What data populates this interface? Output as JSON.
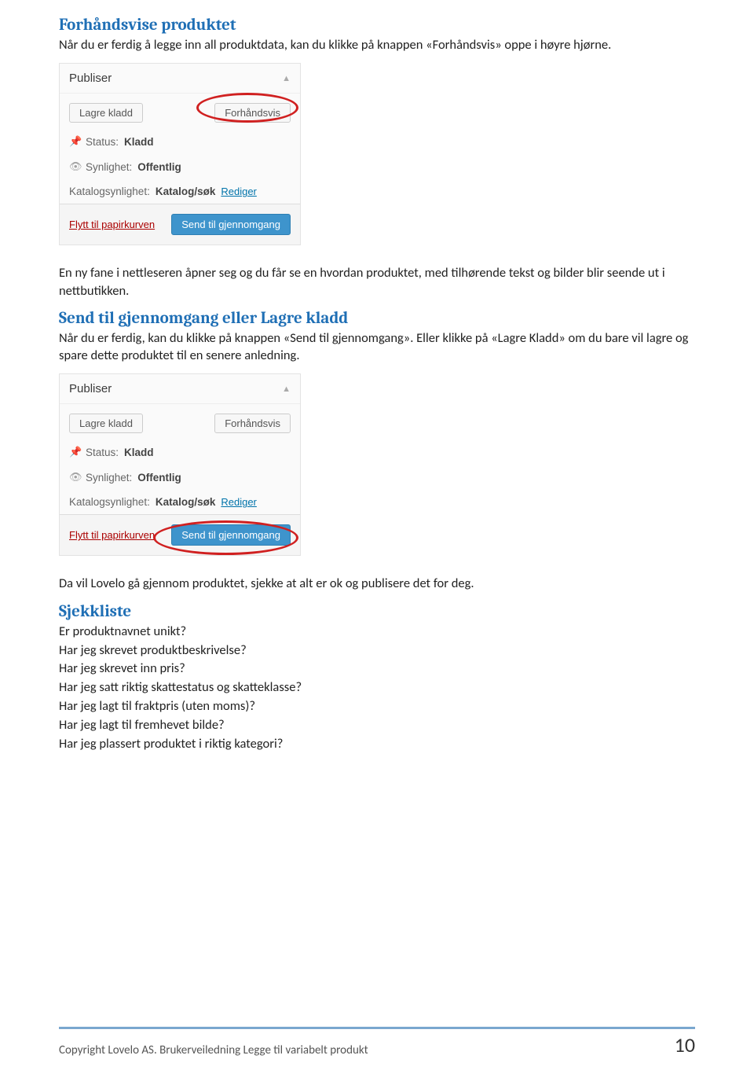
{
  "section1": {
    "heading": "Forhåndsvise produktet",
    "body": "Når du er ferdig å legge inn all produktdata, kan du klikke på knappen «Forhåndsvis» oppe i høyre hjørne."
  },
  "panel": {
    "title": "Publiser",
    "btn_save": "Lagre kladd",
    "btn_preview": "Forhåndsvis",
    "status_label": "Status:",
    "status_value": "Kladd",
    "visibility_label": "Synlighet:",
    "visibility_value": "Offentlig",
    "catalog_label": "Katalogsynlighet:",
    "catalog_value": "Katalog/søk",
    "catalog_edit": "Rediger",
    "trash": "Flytt til papirkurven",
    "submit": "Send til gjennomgang"
  },
  "section2": {
    "body": "En ny fane i nettleseren åpner seg og du får se en hvordan produktet, med tilhørende tekst og bilder blir seende ut i nettbutikken."
  },
  "section3": {
    "heading": "Send til gjennomgang eller Lagre kladd",
    "body": "Når du er ferdig, kan du klikke på knappen «Send til gjennomgang». Eller klikke på «Lagre Kladd» om du bare vil lagre og spare dette produktet til en senere anledning."
  },
  "section4": {
    "body": "Da vil Lovelo gå gjennom produktet, sjekke at alt er ok og publisere det for deg."
  },
  "checklist": {
    "heading": "Sjekkliste",
    "items": [
      "Er produktnavnet unikt?",
      "Har jeg skrevet produktbeskrivelse?",
      "Har jeg skrevet inn pris?",
      "Har jeg satt riktig skattestatus og skatteklasse?",
      "Har jeg lagt til fraktpris (uten moms)?",
      "Har jeg lagt til fremhevet bilde?",
      "Har jeg plassert produktet i riktig kategori?"
    ]
  },
  "footer": {
    "text": "Copyright Lovelo AS. Brukerveiledning Legge til variabelt produkt",
    "page": "10"
  }
}
